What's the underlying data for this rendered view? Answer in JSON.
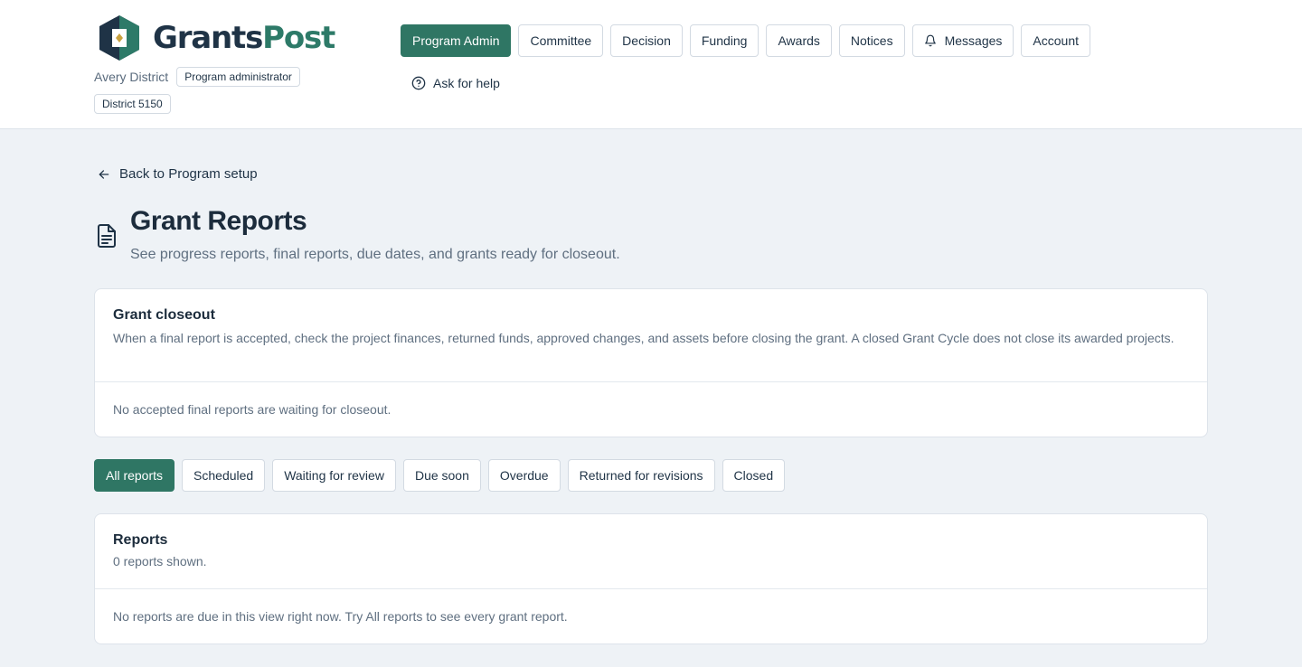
{
  "brand": {
    "name_part1": "Grants",
    "name_part2": "Post",
    "accent": "#2f7664",
    "dark": "#1f3346"
  },
  "org": {
    "name": "Avery District",
    "role": "Program administrator",
    "district": "District 5150"
  },
  "nav": {
    "items": [
      {
        "label": "Program Admin",
        "active": true
      },
      {
        "label": "Committee"
      },
      {
        "label": "Decision"
      },
      {
        "label": "Funding"
      },
      {
        "label": "Awards"
      },
      {
        "label": "Notices"
      },
      {
        "label": "Messages",
        "icon": "bell-icon"
      },
      {
        "label": "Account"
      }
    ],
    "help": "Ask for help"
  },
  "back_link": "Back to Program setup",
  "page": {
    "title": "Grant Reports",
    "subtitle": "See progress reports, final reports, due dates, and grants ready for closeout.",
    "icon": "document-icon"
  },
  "closeout": {
    "title": "Grant closeout",
    "description": "When a final report is accepted, check the project finances, returned funds, approved changes, and assets before closing the grant. A closed Grant Cycle does not close its awarded projects.",
    "empty": "No accepted final reports are waiting for closeout."
  },
  "filters": [
    {
      "label": "All reports",
      "active": true
    },
    {
      "label": "Scheduled"
    },
    {
      "label": "Waiting for review"
    },
    {
      "label": "Due soon"
    },
    {
      "label": "Overdue"
    },
    {
      "label": "Returned for revisions"
    },
    {
      "label": "Closed"
    }
  ],
  "reports": {
    "title": "Reports",
    "count_text": "0 reports shown.",
    "empty": "No reports are due in this view right now. Try All reports to see every grant report."
  }
}
